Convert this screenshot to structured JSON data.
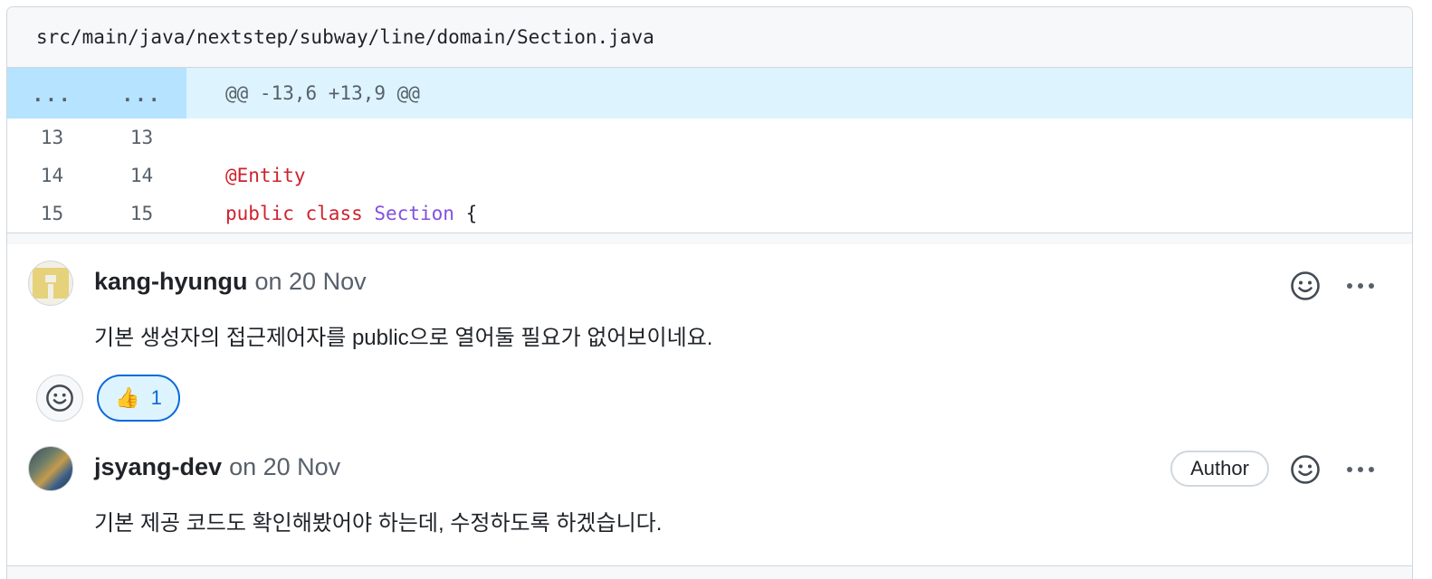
{
  "file": {
    "path": "src/main/java/nextstep/subway/line/domain/Section.java"
  },
  "hunk": {
    "old_marker": "...",
    "new_marker": "...",
    "header": "@@ -13,6 +13,9 @@"
  },
  "lines": [
    {
      "old": "13",
      "new": "13",
      "text": ""
    },
    {
      "old": "14",
      "new": "14",
      "annotation": "@Entity"
    },
    {
      "old": "15",
      "new": "15",
      "keyword1": "public",
      "keyword2": "class",
      "class_name": "Section",
      "brace": "{"
    }
  ],
  "comments": [
    {
      "author": "kang-hyungu",
      "date": "on 20 Nov",
      "body": "기본 생성자의 접근제어자를 public으로 열어둘 필요가 없어보이네요.",
      "reactions": [
        {
          "emoji": "👍",
          "count": "1"
        }
      ]
    },
    {
      "author": "jsyang-dev",
      "date": "on 20 Nov",
      "badge": "Author",
      "body": "기본 제공 코드도 확인해봤어야 하는데, 수정하도록 하겠습니다."
    }
  ],
  "colors": {
    "accent": "#0969da",
    "hunk_bg": "#ddf4ff",
    "hunk_num_bg": "#b6e3ff",
    "keyword": "#cf222e",
    "class": "#8250df"
  },
  "icons": [
    "smiley-icon",
    "kebab-horizontal-icon",
    "thumbs-up-icon"
  ]
}
